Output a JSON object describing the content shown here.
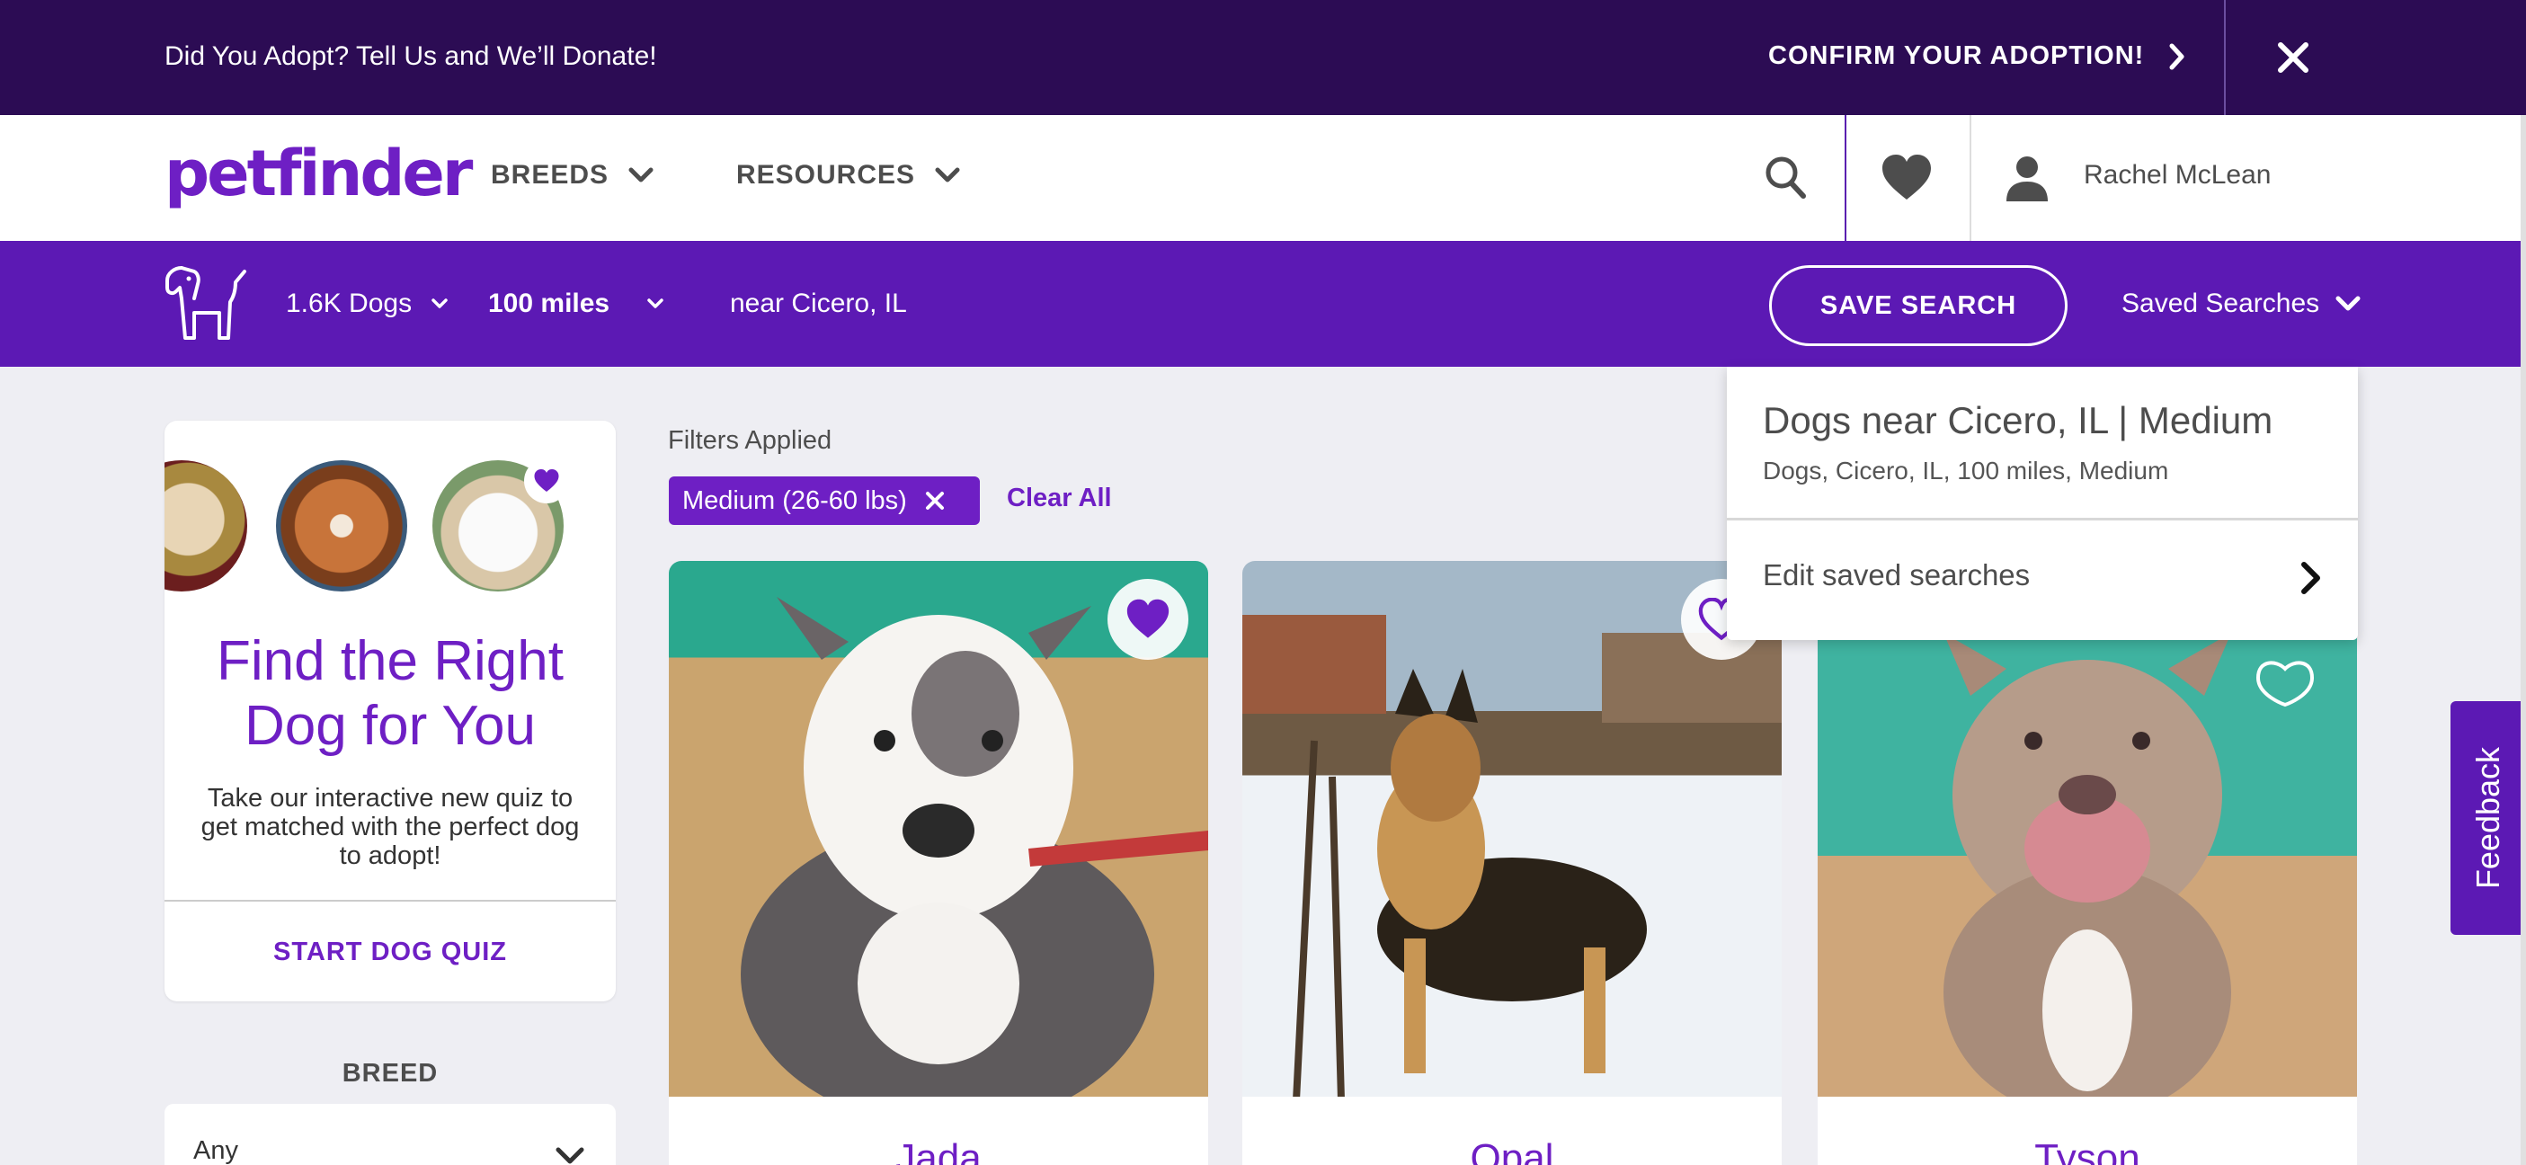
{
  "promo": {
    "message": "Did You Adopt? Tell Us and We’ll Donate!",
    "cta": "CONFIRM YOUR ADOPTION!"
  },
  "header": {
    "logo": "petfinder",
    "nav": {
      "breeds": "BREEDS",
      "resources": "RESOURCES"
    },
    "user_name": "Rachel McLean"
  },
  "searchbar": {
    "animal_count": "1.6K Dogs",
    "distance": "100 miles",
    "location": "near Cicero, IL",
    "save_button": "SAVE SEARCH",
    "saved_searches": "Saved Searches"
  },
  "saved_dropdown": {
    "title": "Dogs near Cicero, IL | Medium",
    "subtitle": "Dogs, Cicero, IL, 100 miles, Medium",
    "edit_label": "Edit saved searches"
  },
  "quiz": {
    "title_line1": "Find the Right",
    "title_line2": "Dog for You",
    "text": "Take our interactive new quiz to get matched with the perfect dog to adopt!",
    "cta": "START DOG QUIZ"
  },
  "breed_filter": {
    "label": "BREED",
    "value": "Any"
  },
  "filters": {
    "label": "Filters Applied",
    "chips": [
      "Medium (26-60 lbs)"
    ],
    "clear_all": "Clear All"
  },
  "pets": [
    {
      "name": "Jada",
      "favorited": true
    },
    {
      "name": "Opal",
      "favorited": false
    },
    {
      "name": "Tyson",
      "favorited": false
    }
  ],
  "feedback": "Feedback",
  "colors": {
    "brand_purple": "#6e1fc4",
    "searchbar_purple": "#5c19b4",
    "promo_dark": "#2c0c54"
  }
}
